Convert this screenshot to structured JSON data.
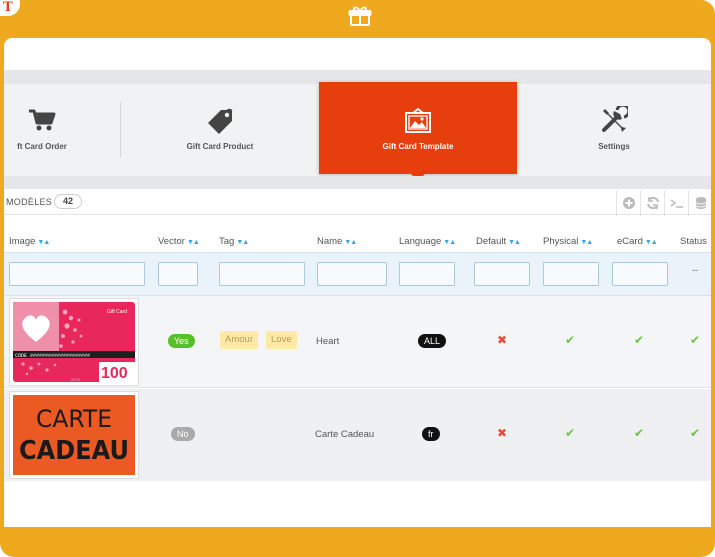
{
  "app": {
    "logo_letter": "T"
  },
  "nav": {
    "items": [
      {
        "label": "ft Card Order",
        "icon": "cart-icon"
      },
      {
        "label": "Gift Card Product",
        "icon": "tag-icon"
      },
      {
        "label": "Gift Card Template",
        "icon": "image-icon",
        "active": true
      },
      {
        "label": "Settings",
        "icon": "tools-icon"
      }
    ]
  },
  "panel": {
    "title": "MODÈLES",
    "count": "42"
  },
  "columns": [
    "Image",
    "Vector",
    "Tag",
    "Name",
    "Language",
    "Default",
    "Physical",
    "eCard",
    "Status"
  ],
  "filter": {
    "status_placeholder": "--"
  },
  "rows": [
    {
      "image": {
        "brand": "Gift Card",
        "code_label": "CODE ####################",
        "amount": "100",
        "small": "2025"
      },
      "vector": "Yes",
      "tags": [
        "Amour",
        "Love"
      ],
      "name": "Heart",
      "language": "ALL",
      "default": "cross",
      "physical": "check",
      "ecard": "check",
      "status": "check"
    },
    {
      "image": {
        "line1": "CARTE",
        "line2": "CADEAU"
      },
      "vector": "No",
      "tags": [],
      "name": "Carte Cadeau",
      "language": "fr",
      "default": "cross",
      "physical": "check",
      "ecard": "check",
      "status": "check"
    }
  ],
  "colors": {
    "frame": "#eea91f",
    "active_tab": "#e63e0c",
    "yes": "#56c02b",
    "check": "#72c046",
    "cross": "#e84c3d"
  }
}
